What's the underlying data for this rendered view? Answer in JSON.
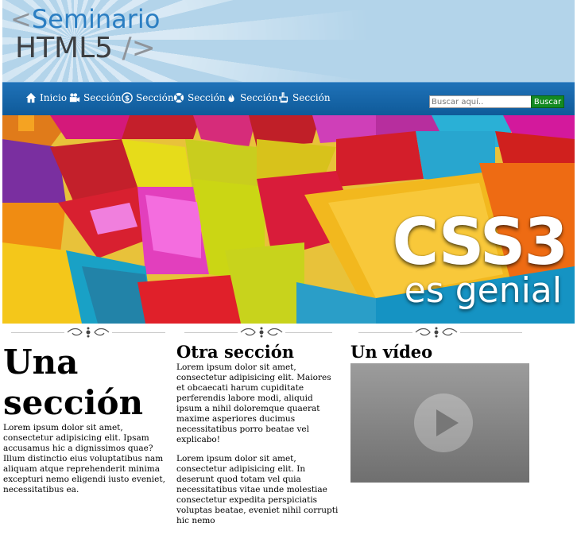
{
  "header": {
    "logo_line1_bracket": "<",
    "logo_line1_text": "Seminario",
    "logo_line2_text": "HTML5",
    "logo_line2_bracket": "/>"
  },
  "nav": {
    "items": [
      {
        "label": "Inicio",
        "icon": "home-icon"
      },
      {
        "label": "Sección",
        "icon": "video-camera-icon"
      },
      {
        "label": "Sección",
        "icon": "dollar-circle-icon"
      },
      {
        "label": "Sección",
        "icon": "support-icon"
      },
      {
        "label": "Sección",
        "icon": "fire-icon"
      },
      {
        "label": "Sección",
        "icon": "hand-up-icon"
      }
    ],
    "search_placeholder": "Buscar aquí..",
    "search_button": "Buscar"
  },
  "banner": {
    "line1": "CSS3",
    "line2": "es genial"
  },
  "columns": {
    "col1": {
      "heading": "Una sección",
      "text": "Lorem ipsum dolor sit amet, consectetur adipisicing elit. Ipsam accusamus hic a dignissimos quae? Illum distinctio eius voluptatibus nam aliquam atque reprehenderit minima excepturi nemo eligendi iusto eveniet, necessitatibus ea."
    },
    "col2": {
      "heading": "Otra sección",
      "p1": "Lorem ipsum dolor sit amet, consectetur adipisicing elit. Maiores et obcaecati harum cupiditate perferendis labore modi, aliquid ipsum a nihil doloremque quaerat maxime asperiores ducimus necessitatibus porro beatae vel explicabo!",
      "p2": "Lorem ipsum dolor sit amet, consectetur adipisicing elit. In deserunt quod totam vel quia necessitatibus vitae unde molestiae consectetur expedita perspiciatis voluptas beatae, eveniet nihil corrupti hic nemo"
    },
    "col3": {
      "heading": "Un vídeo"
    }
  },
  "colors": {
    "header_bg": "#b3d4ea",
    "nav_bg": "#1565a8",
    "logo_blue": "#2b7ec2",
    "search_button_bg": "#138a22"
  }
}
